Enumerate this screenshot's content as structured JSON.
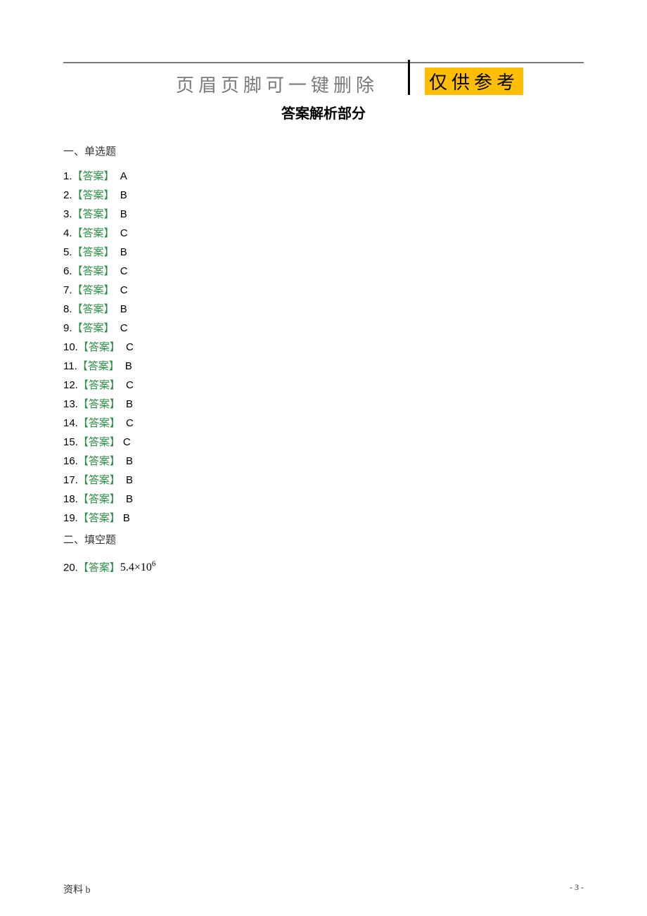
{
  "header": {
    "left_text": "页眉页脚可一键删除",
    "right_text": "仅供参考"
  },
  "title": "答案解析部分",
  "section1": {
    "heading": "一、单选题",
    "answers": [
      {
        "n": "1.",
        "label": "【答案】",
        "val": " A"
      },
      {
        "n": "2.",
        "label": "【答案】",
        "val": " B"
      },
      {
        "n": "3.",
        "label": "【答案】",
        "val": " B"
      },
      {
        "n": "4.",
        "label": "【答案】",
        "val": " C"
      },
      {
        "n": "5.",
        "label": "【答案】",
        "val": " B"
      },
      {
        "n": "6.",
        "label": "【答案】",
        "val": " C"
      },
      {
        "n": "7.",
        "label": "【答案】",
        "val": " C"
      },
      {
        "n": "8.",
        "label": "【答案】",
        "val": " B"
      },
      {
        "n": "9.",
        "label": "【答案】",
        "val": " C"
      },
      {
        "n": "10.",
        "label": "【答案】",
        "val": " C"
      },
      {
        "n": "11.",
        "label": "【答案】",
        "val": " B"
      },
      {
        "n": "12.",
        "label": "【答案】",
        "val": " C"
      },
      {
        "n": "13.",
        "label": "【答案】",
        "val": " B"
      },
      {
        "n": "14.",
        "label": "【答案】",
        "val": " C"
      },
      {
        "n": "15.",
        "label": "【答案】",
        "val": "C"
      },
      {
        "n": "16.",
        "label": "【答案】",
        "val": " B"
      },
      {
        "n": "17.",
        "label": "【答案】",
        "val": " B"
      },
      {
        "n": "18.",
        "label": "【答案】",
        "val": " B"
      },
      {
        "n": "19.",
        "label": "【答案】",
        "val": "B"
      }
    ]
  },
  "section2": {
    "heading": "二、填空题",
    "answer": {
      "n": "20.",
      "label": "【答案】",
      "formula_base": "5.4×10",
      "formula_exp": "6"
    }
  },
  "footer": {
    "left": "资料 b",
    "right": "- 3 -"
  }
}
